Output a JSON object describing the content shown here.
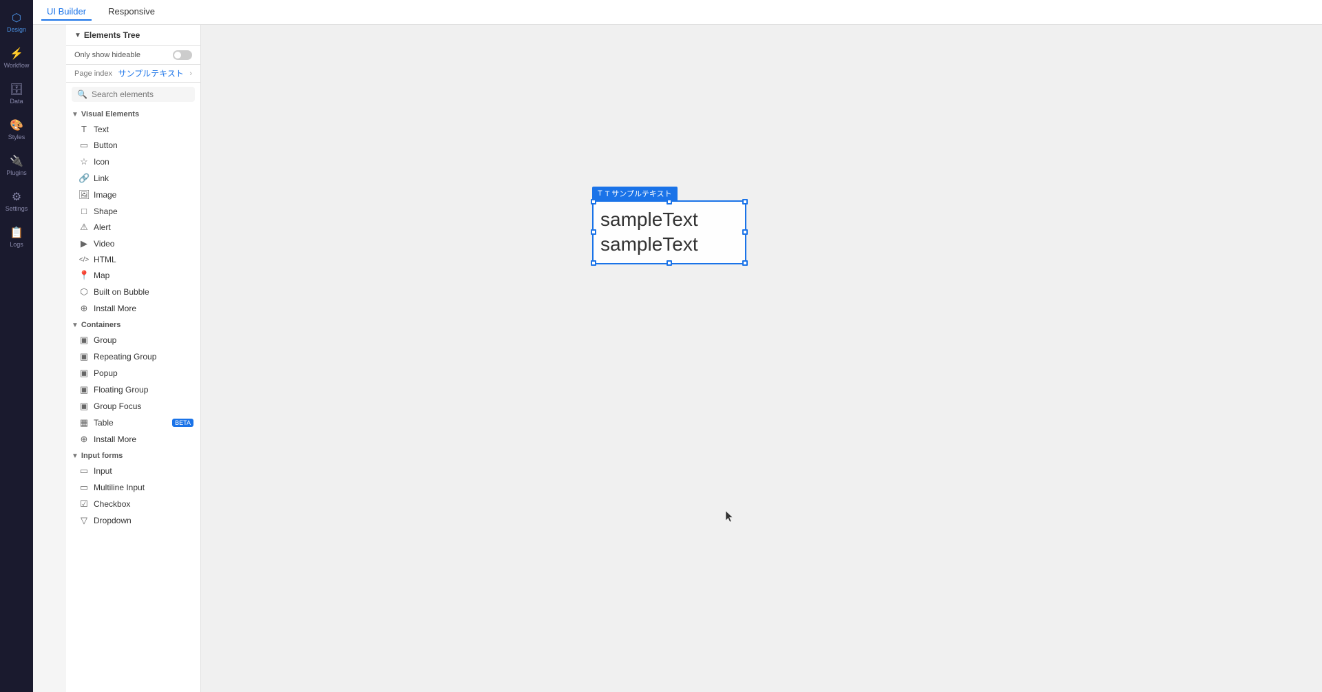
{
  "app": {
    "title": "Bubble UI Builder"
  },
  "topbar": {
    "tabs": [
      {
        "id": "ui-builder",
        "label": "UI Builder",
        "active": true
      },
      {
        "id": "responsive",
        "label": "Responsive",
        "active": false
      }
    ]
  },
  "vertical_nav": {
    "items": [
      {
        "id": "design",
        "label": "Design",
        "icon": "⬡",
        "active": true
      },
      {
        "id": "workflow",
        "label": "Workflow",
        "icon": "⚡",
        "active": false
      },
      {
        "id": "data",
        "label": "Data",
        "icon": "🗄",
        "active": false
      },
      {
        "id": "styles",
        "label": "Styles",
        "icon": "🎨",
        "active": false
      },
      {
        "id": "plugins",
        "label": "Plugins",
        "icon": "🔌",
        "active": false
      },
      {
        "id": "settings",
        "label": "Settings",
        "icon": "⚙",
        "active": false
      },
      {
        "id": "logs",
        "label": "Logs",
        "icon": "📋",
        "active": false
      }
    ]
  },
  "sidebar": {
    "elements_tree_label": "Elements Tree",
    "only_show_hideable": "Only show hideable",
    "page_index_label": "Page index",
    "page_name": "サンプルテキスト",
    "search_placeholder": "Search elements",
    "visual_elements_label": "Visual Elements",
    "containers_label": "Containers",
    "input_forms_label": "Input forms",
    "visual_elements": [
      {
        "id": "text",
        "label": "Text",
        "icon": "T"
      },
      {
        "id": "button",
        "label": "Button",
        "icon": "▭"
      },
      {
        "id": "icon",
        "label": "Icon",
        "icon": "☆"
      },
      {
        "id": "link",
        "label": "Link",
        "icon": "🔗"
      },
      {
        "id": "image",
        "label": "Image",
        "icon": "🖼"
      },
      {
        "id": "shape",
        "label": "Shape",
        "icon": "□"
      },
      {
        "id": "alert",
        "label": "Alert",
        "icon": "⚠"
      },
      {
        "id": "video",
        "label": "Video",
        "icon": "▶"
      },
      {
        "id": "html",
        "label": "HTML",
        "icon": "</>"
      },
      {
        "id": "map",
        "label": "Map",
        "icon": "📍"
      },
      {
        "id": "built-on-bubble",
        "label": "Built on Bubble",
        "icon": "⬡"
      },
      {
        "id": "install-more-visual",
        "label": "Install More",
        "icon": "⊕"
      }
    ],
    "containers": [
      {
        "id": "group",
        "label": "Group",
        "icon": "▣"
      },
      {
        "id": "repeating-group",
        "label": "Repeating Group",
        "icon": "▣"
      },
      {
        "id": "popup",
        "label": "Popup",
        "icon": "▣"
      },
      {
        "id": "floating-group",
        "label": "Floating Group",
        "icon": "▣"
      },
      {
        "id": "group-focus",
        "label": "Group Focus",
        "icon": "▣"
      },
      {
        "id": "table",
        "label": "Table",
        "icon": "▦",
        "badge": "BETA"
      },
      {
        "id": "install-more-containers",
        "label": "Install More",
        "icon": "⊕"
      }
    ],
    "input_forms": [
      {
        "id": "input",
        "label": "Input",
        "icon": "▭"
      },
      {
        "id": "multiline-input",
        "label": "Multiline Input",
        "icon": "▭"
      },
      {
        "id": "checkbox",
        "label": "Checkbox",
        "icon": "☑"
      },
      {
        "id": "dropdown",
        "label": "Dropdown",
        "icon": "▽"
      }
    ]
  },
  "canvas": {
    "text_element": {
      "label": "T サンプルテキスト",
      "line1": "sampleText",
      "line2": "sampleText"
    }
  }
}
